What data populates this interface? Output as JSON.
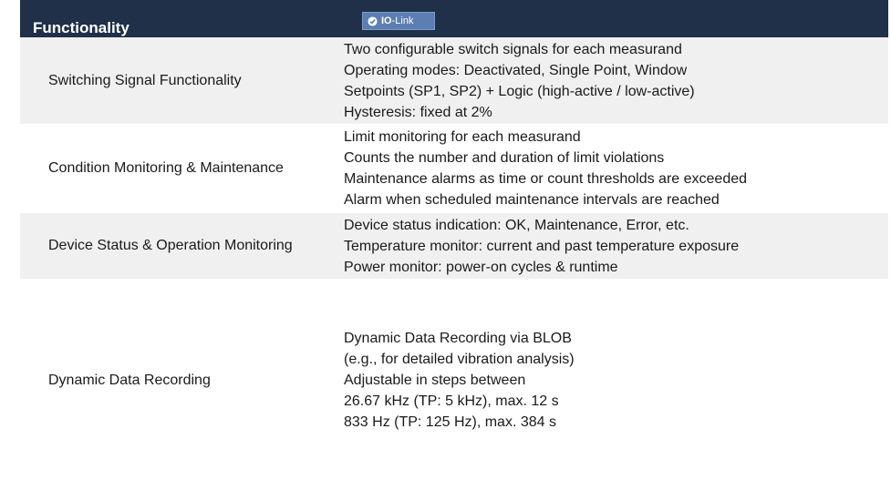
{
  "header": {
    "title": "Functionality",
    "badge_strong": "IO",
    "badge_weak": "-Link"
  },
  "rows": [
    {
      "label": "Switching Signal Functionality",
      "lines": [
        "Two configurable switch signals for each measurand",
        "Operating modes: Deactivated, Single Point, Window",
        "Setpoints (SP1, SP2) + Logic (high-active / low-active)",
        "Hysteresis: fixed at 2%"
      ]
    },
    {
      "label": "Condition Monitoring & Maintenance",
      "lines": [
        "Limit monitoring for each measurand",
        "Counts the number and duration of limit violations",
        "Maintenance alarms as time or count thresholds are exceeded",
        "Alarm when scheduled maintenance intervals are reached"
      ]
    },
    {
      "label": "Device Status & Operation Monitoring",
      "lines": [
        "Device status indication: OK, Maintenance, Error, etc.",
        "Temperature monitor: current and past temperature exposure",
        "Power monitor: power-on cycles & runtime"
      ]
    },
    {
      "label": "Dynamic Data Recording",
      "lines": [
        "Dynamic Data Recording via BLOB",
        "(e.g., for detailed vibration analysis)",
        "Adjustable in steps between",
        "26.67 kHz (TP: 5 kHz), max. 12 s",
        "833 Hz (TP: 125 Hz), max. 384 s"
      ]
    }
  ],
  "colors": {
    "header_bg": "#1f3048",
    "badge_bg": "#5b7fb3",
    "row_shade": "#f0f0f0",
    "row_white": "#ffffff"
  },
  "icons": {
    "badge_logo": "io-link-logo-icon"
  }
}
